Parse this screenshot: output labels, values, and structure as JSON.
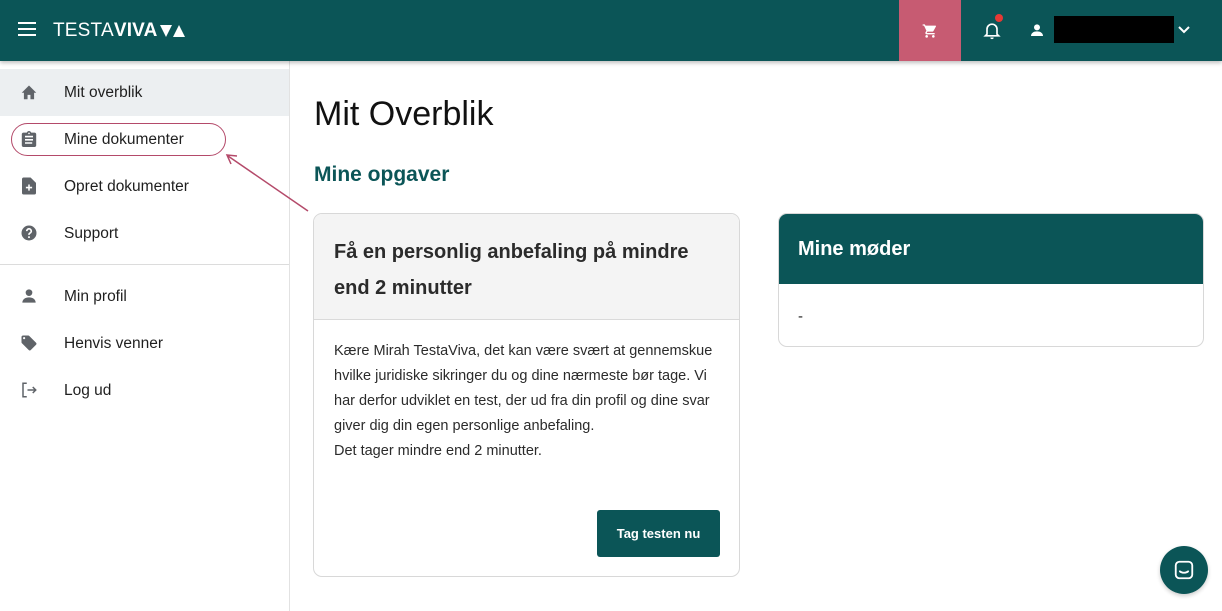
{
  "header": {
    "logo_light": "TESTA",
    "logo_bold": "VIVA",
    "user_name": "",
    "colors": {
      "bar": "#0b5557",
      "cart": "#c75b72",
      "notification_dot": "#e53935"
    }
  },
  "sidebar": {
    "items": [
      {
        "label": "Mit overblik",
        "icon": "home-icon",
        "active": true
      },
      {
        "label": "Mine dokumenter",
        "icon": "clipboard-icon",
        "active": false
      },
      {
        "label": "Opret dokumenter",
        "icon": "file-plus-icon",
        "active": false
      },
      {
        "label": "Support",
        "icon": "help-circle-icon",
        "active": false
      },
      {
        "label": "Min profil",
        "icon": "person-icon",
        "active": false
      },
      {
        "label": "Henvis venner",
        "icon": "tag-icon",
        "active": false
      },
      {
        "label": "Log ud",
        "icon": "logout-icon",
        "active": false
      }
    ]
  },
  "main": {
    "title": "Mit Overblik",
    "tasks_heading": "Mine opgaver",
    "task_card": {
      "title": "Få en personlig anbefaling på mindre end 2 minutter",
      "body_line1": "Kære Mirah TestaViva, det kan være svært at gennemskue hvilke juridiske sikringer du og dine nærmeste bør tage. Vi har derfor udviklet en test, der ud fra din profil og dine svar giver dig din egen personlige anbefaling.",
      "body_line2": "Det tager mindre end 2 minutter.",
      "button": "Tag testen nu"
    },
    "meetings_card": {
      "title": "Mine møder",
      "value": "-"
    }
  }
}
